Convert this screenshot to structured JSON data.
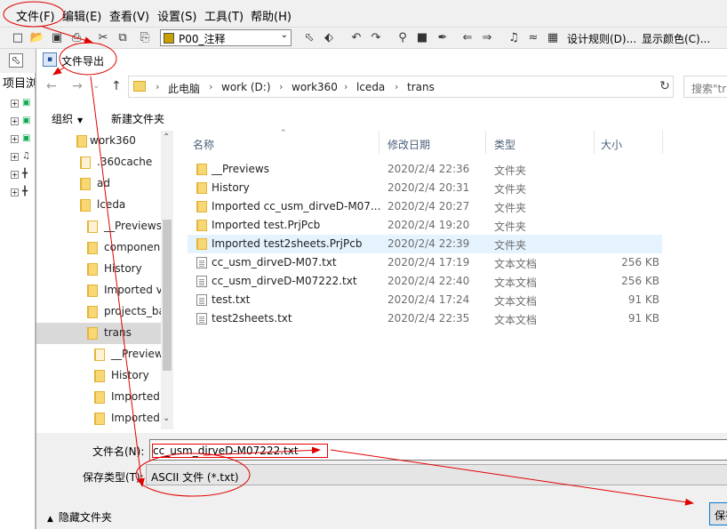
{
  "menubar": {
    "items": [
      "文件(F)",
      "编辑(E)",
      "查看(V)",
      "设置(S)",
      "工具(T)",
      "帮助(H)"
    ]
  },
  "toolbar": {
    "layer_value": "P00_注释",
    "design_rules_label": "设计规则(D)...",
    "display_color_label": "显示颜色(C)..."
  },
  "left_panel": {
    "title": "项目浏览"
  },
  "dialog": {
    "title": "文件导出",
    "breadcrumb": [
      "此电脑",
      "work (D:)",
      "work360",
      "lceda",
      "trans"
    ],
    "search_placeholder": "搜索\"trans\"",
    "organize_label": "组织",
    "new_folder_label": "新建文件夹",
    "nav_tree": [
      {
        "label": "work360"
      },
      {
        "label": ".360cache"
      },
      {
        "label": "ad"
      },
      {
        "label": "lceda"
      },
      {
        "label": "__Previews"
      },
      {
        "label": "componen"
      },
      {
        "label": "History"
      },
      {
        "label": "Imported v"
      },
      {
        "label": "projects_ba"
      },
      {
        "label": "trans"
      },
      {
        "label": "__Preview"
      },
      {
        "label": "History"
      },
      {
        "label": "Imported"
      },
      {
        "label": "Imported"
      }
    ],
    "columns": {
      "name": "名称",
      "date": "修改日期",
      "type": "类型",
      "size": "大小"
    },
    "files": [
      {
        "name": "__Previews",
        "date": "2020/2/4 22:36",
        "type": "文件夹",
        "size": "",
        "kind": "folder"
      },
      {
        "name": "History",
        "date": "2020/2/4 20:31",
        "type": "文件夹",
        "size": "",
        "kind": "folder"
      },
      {
        "name": "Imported cc_usm_dirveD-M07...",
        "date": "2020/2/4 20:27",
        "type": "文件夹",
        "size": "",
        "kind": "folder"
      },
      {
        "name": "Imported test.PrjPcb",
        "date": "2020/2/4 19:20",
        "type": "文件夹",
        "size": "",
        "kind": "folder"
      },
      {
        "name": "Imported test2sheets.PrjPcb",
        "date": "2020/2/4 22:39",
        "type": "文件夹",
        "size": "",
        "kind": "folder"
      },
      {
        "name": "cc_usm_dirveD-M07.txt",
        "date": "2020/2/4 17:19",
        "type": "文本文档",
        "size": "256 KB",
        "kind": "doc"
      },
      {
        "name": "cc_usm_dirveD-M07222.txt",
        "date": "2020/2/4 22:40",
        "type": "文本文档",
        "size": "256 KB",
        "kind": "doc"
      },
      {
        "name": "test.txt",
        "date": "2020/2/4 17:24",
        "type": "文本文档",
        "size": "91 KB",
        "kind": "doc"
      },
      {
        "name": "test2sheets.txt",
        "date": "2020/2/4 22:35",
        "type": "文本文档",
        "size": "91 KB",
        "kind": "doc"
      }
    ],
    "filename_label": "文件名(N):",
    "filename_value": "cc_usm_dirveD-M07222.txt",
    "filetype_label": "保存类型(T):",
    "filetype_value": "ASCII 文件 (*.txt)",
    "hide_folders_label": "隐藏文件夹",
    "save_label": "保存"
  },
  "colors": {
    "annotation": "#e00000",
    "selection": "#cce8ff",
    "row_hover": "#e5f3ff",
    "accent": "#0078d7"
  }
}
